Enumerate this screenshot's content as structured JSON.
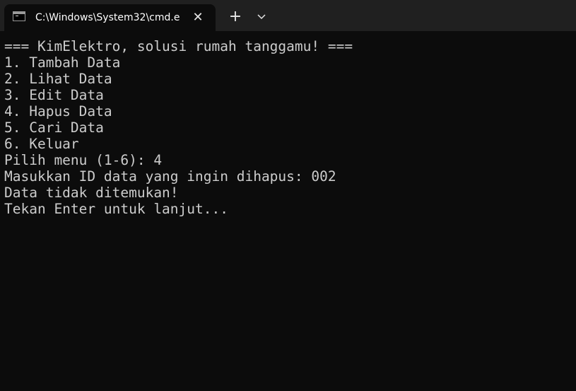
{
  "tab": {
    "title": "C:\\Windows\\System32\\cmd.e",
    "icon": "cmd-terminal-icon",
    "close_glyph": "✕"
  },
  "toolbar": {
    "new_tab_glyph": "+",
    "dropdown_icon": "chevron-down-icon"
  },
  "colors": {
    "titlebar": "#202020",
    "terminal_bg": "#0c0c0c",
    "terminal_text": "#cccccc"
  },
  "terminal": {
    "lines": [
      "=== KimElektro, solusi rumah tanggamu! ===",
      "1. Tambah Data",
      "2. Lihat Data",
      "3. Edit Data",
      "4. Hapus Data",
      "5. Cari Data",
      "6. Keluar",
      "Pilih menu (1-6): 4",
      "Masukkan ID data yang ingin dihapus: 002",
      "Data tidak ditemukan!",
      "Tekan Enter untuk lanjut..."
    ]
  }
}
